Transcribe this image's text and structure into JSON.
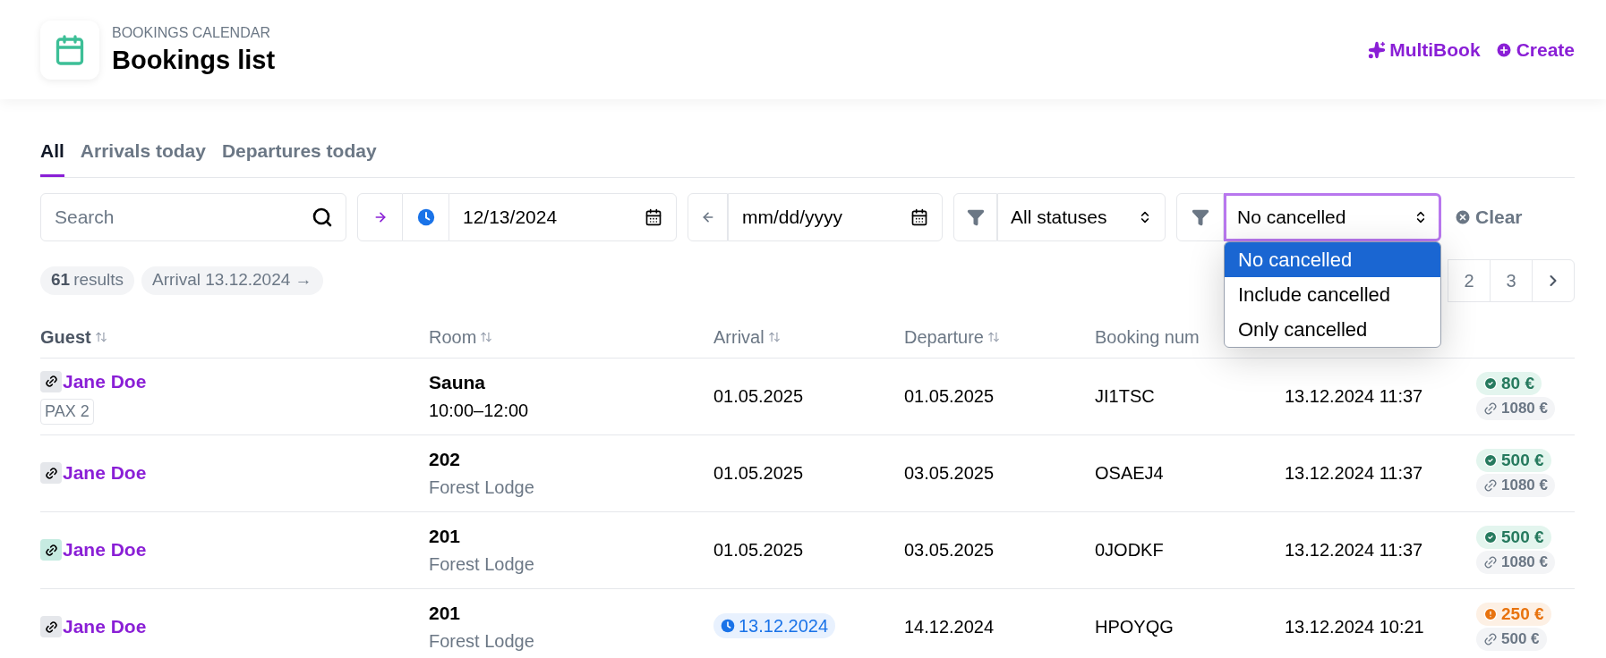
{
  "header": {
    "eyebrow": "BOOKINGS CALENDAR",
    "title": "Bookings list",
    "actions": [
      {
        "kind": "sparkle",
        "label": "MultiBook"
      },
      {
        "kind": "plus",
        "label": "Create"
      }
    ]
  },
  "tabs": [
    {
      "label": "All",
      "selected": true
    },
    {
      "label": "Arrivals today",
      "selected": false
    },
    {
      "label": "Departures today",
      "selected": false
    }
  ],
  "filters": {
    "search": {
      "placeholder": "Search"
    },
    "arrival_date": "12/13/2024",
    "departure_date": "mm/dd/yyyy",
    "status_select": "All statuses",
    "cancel_select": {
      "value": "No cancelled",
      "expanded": true,
      "options": [
        {
          "label": "No cancelled",
          "selected": true
        },
        {
          "label": "Include cancelled",
          "selected": false
        },
        {
          "label": "Only cancelled",
          "selected": false
        }
      ]
    },
    "clear": "Clear"
  },
  "summary": {
    "count": "61",
    "count_label": "results",
    "chip": "Arrival 13.12.2024 →"
  },
  "pagination": [
    {
      "label": "2",
      "selected": false
    },
    {
      "label": "3",
      "selected": false
    }
  ],
  "table": {
    "columns": [
      "Guest",
      "Room",
      "Arrival",
      "Departure",
      "Booking num"
    ],
    "rows": [
      {
        "guest": "Jane Doe",
        "color": "#e5e7eb",
        "pax": "PAX 2",
        "room": "Sauna",
        "room_detail": {
          "text": "10:00–12:00",
          "kind": "time"
        },
        "arrival": "01.05.2025",
        "arrival_today": false,
        "departure": "01.05.2025",
        "booking": "JI1TSC",
        "created": "13.12.2024 11:37",
        "price": {
          "text": "80 €",
          "kind": "paid"
        },
        "total": "1080 €"
      },
      {
        "guest": "Jane Doe",
        "color": "#e5e7eb",
        "room": "202",
        "room_detail": {
          "text": "Forest Lodge",
          "kind": "place"
        },
        "arrival": "01.05.2025",
        "arrival_today": false,
        "departure": "03.05.2025",
        "booking": "OSAEJ4",
        "created": "13.12.2024 11:37",
        "price": {
          "text": "500 €",
          "kind": "paid"
        },
        "total": "1080 €"
      },
      {
        "guest": "Jane Doe",
        "color": "#c6ebe1",
        "room": "201",
        "room_detail": {
          "text": "Forest Lodge",
          "kind": "place"
        },
        "arrival": "01.05.2025",
        "arrival_today": false,
        "departure": "03.05.2025",
        "booking": "0JODKF",
        "created": "13.12.2024 11:37",
        "price": {
          "text": "500 €",
          "kind": "paid"
        },
        "total": "1080 €"
      },
      {
        "guest": "Jane Doe",
        "color": "#e5e7eb",
        "room": "201",
        "room_detail": {
          "text": "Forest Lodge",
          "kind": "place"
        },
        "arrival": "13.12.2024",
        "arrival_today": true,
        "departure": "14.12.2024",
        "booking": "HPOYQG",
        "created": "13.12.2024 10:21",
        "price": {
          "text": "250 €",
          "kind": "pending"
        },
        "total": "500 €"
      }
    ]
  }
}
